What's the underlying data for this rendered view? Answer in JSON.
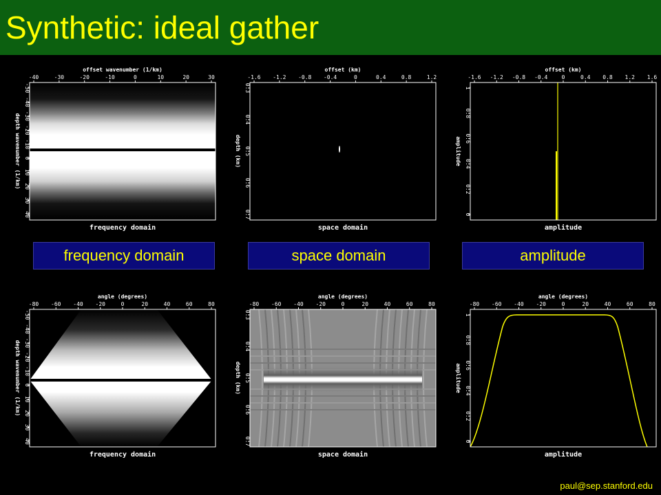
{
  "title": "Synthetic: ideal gather",
  "footer": "paul@sep.stanford.edu",
  "colors": {
    "title_bar": "#0c6010",
    "title_text": "#ffff00",
    "label_bar": "#0a0a7a",
    "curve": "#ffff00"
  },
  "labels": [
    "frequency domain",
    "space domain",
    "amplitude"
  ],
  "panels": {
    "top_freq": {
      "top_label": "offset wavenumber (1/km)",
      "xticks": [
        "-40",
        "-30",
        "-20",
        "-10",
        "0",
        "10",
        "20",
        "30"
      ],
      "left_label": "depth wavenumber (1/km)",
      "yticks": [
        "-50",
        "-40",
        "-30",
        "-20",
        "-10",
        "0",
        "10",
        "20",
        "30",
        "40"
      ],
      "caption": "frequency domain"
    },
    "top_space": {
      "top_label": "offset (km)",
      "xticks": [
        "-1.6",
        "-1.2",
        "-0.8",
        "-0.4",
        "0",
        "0.4",
        "0.8",
        "1.2"
      ],
      "left_label": "depth (km)",
      "yticks": [
        "0.3",
        "0.4",
        "0.5",
        "0.6",
        "0.7"
      ],
      "caption": "space domain"
    },
    "top_amp": {
      "top_label": "offset (km)",
      "xticks": [
        "-1.6",
        "-1.2",
        "-0.8",
        "-0.4",
        "0",
        "0.4",
        "0.8",
        "1.2",
        "1.6"
      ],
      "left_label": "amplitude",
      "yticks": [
        "1",
        "0.8",
        "0.6",
        "0.4",
        "0.2",
        "0"
      ],
      "caption": "amplitude"
    },
    "bot_freq": {
      "top_label": "angle (degrees)",
      "xticks": [
        "-80",
        "-60",
        "-40",
        "-20",
        "0",
        "20",
        "40",
        "60",
        "80"
      ],
      "left_label": "depth wavenumber (1/km)",
      "yticks": [
        "-50",
        "-40",
        "-30",
        "-20",
        "-10",
        "0",
        "10",
        "20",
        "30",
        "40"
      ],
      "caption": "frequency domain"
    },
    "bot_space": {
      "top_label": "angle (degrees)",
      "xticks": [
        "-80",
        "-60",
        "-40",
        "-20",
        "0",
        "20",
        "40",
        "60",
        "80"
      ],
      "left_label": "depth (km)",
      "yticks": [
        "0.3",
        "0.4",
        "0.5",
        "0.6",
        "0.7"
      ],
      "caption": "space domain"
    },
    "bot_amp": {
      "top_label": "angle (degrees)",
      "xticks": [
        "-80",
        "-60",
        "-40",
        "-20",
        "0",
        "20",
        "40",
        "60",
        "80"
      ],
      "left_label": "amplitude",
      "yticks": [
        "1",
        "0.8",
        "0.6",
        "0.4",
        "0.2",
        "0"
      ],
      "caption": "amplitude"
    }
  }
}
